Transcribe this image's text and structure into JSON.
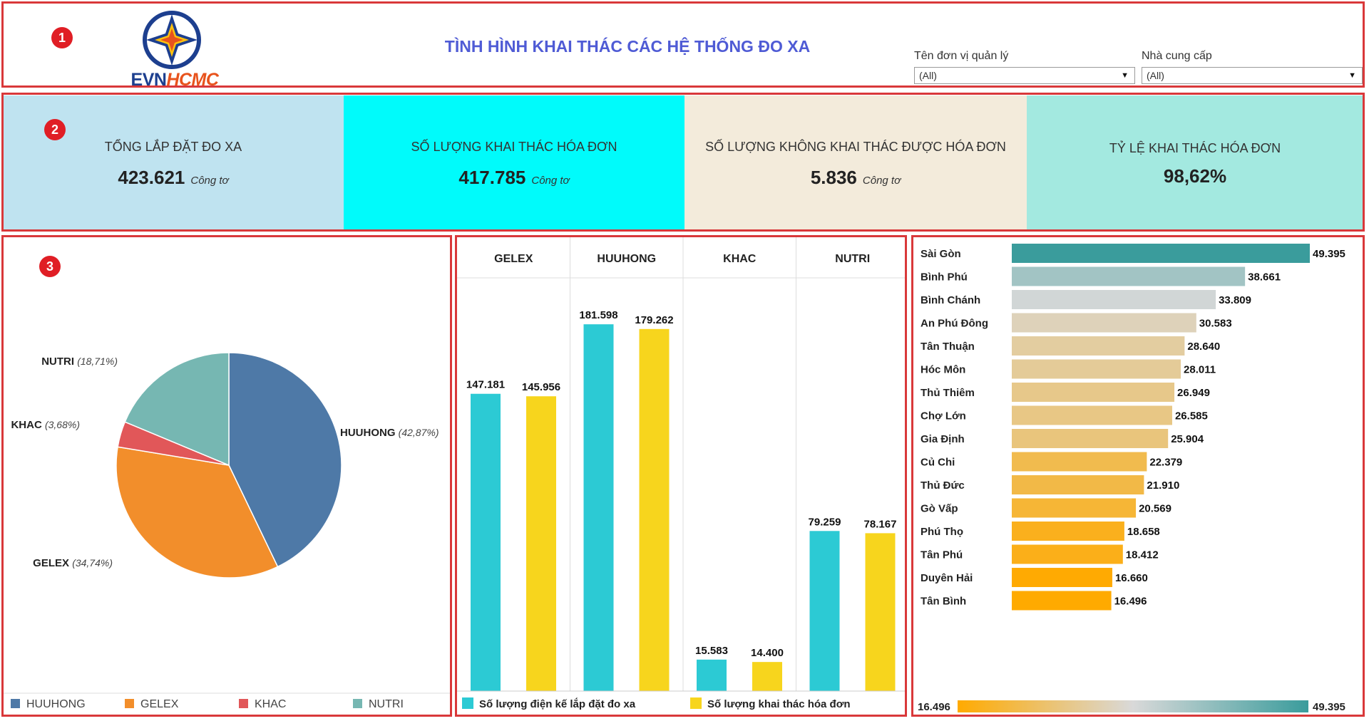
{
  "header": {
    "logo_text_1": "EVN",
    "logo_text_2": "HCMC",
    "title": "TÌNH HÌNH KHAI THÁC CÁC HỆ THỐNG ĐO XA",
    "filters": [
      {
        "label": "Tên đơn vị quản lý",
        "value": "(All)"
      },
      {
        "label": "Nhà cung cấp",
        "value": "(All)"
      }
    ]
  },
  "badges": [
    "1",
    "2",
    "3"
  ],
  "kpis": [
    {
      "label": "TỔNG LẮP ĐẶT ĐO XA",
      "value": "423.621",
      "unit": "Công tơ",
      "bg": "#bfe3f0"
    },
    {
      "label": "SỐ LƯỢNG KHAI THÁC HÓA ĐƠN",
      "value": "417.785",
      "unit": "Công tơ",
      "bg": "#00fbfb"
    },
    {
      "label": "SỐ LƯỢNG KHÔNG KHAI THÁC ĐƯỢC HÓA  ĐƠN",
      "value": "5.836",
      "unit": "Công tơ",
      "bg": "#f3ebdb"
    },
    {
      "label": "TỶ LỆ KHAI THÁC HÓA ĐƠN",
      "value": "98,62%",
      "unit": "",
      "bg": "#a3e9e0"
    }
  ],
  "chart_data": [
    {
      "type": "pie",
      "slices": [
        {
          "name": "HUUHONG",
          "pct_label": "(42,87%)",
          "value": 42.87,
          "color": "#4e79a7"
        },
        {
          "name": "GELEX",
          "pct_label": "(34,74%)",
          "value": 34.74,
          "color": "#f28e2b"
        },
        {
          "name": "KHAC",
          "pct_label": "(3,68%)",
          "value": 3.68,
          "color": "#e15759"
        },
        {
          "name": "NUTRI",
          "pct_label": "(18,71%)",
          "value": 18.71,
          "color": "#76b7b2"
        }
      ],
      "legend": [
        {
          "name": "HUUHONG",
          "color": "#4e79a7"
        },
        {
          "name": "GELEX",
          "color": "#f28e2b"
        },
        {
          "name": "KHAC",
          "color": "#e15759"
        },
        {
          "name": "NUTRI",
          "color": "#76b7b2"
        }
      ],
      "legend_position": "bottom"
    },
    {
      "type": "bar",
      "categories": [
        "GELEX",
        "HUUHONG",
        "KHAC",
        "NUTRI"
      ],
      "series": [
        {
          "name": "Số lượng điện kế lắp đặt đo xa",
          "color": "#2ccad4",
          "values": [
            147181,
            181598,
            15583,
            79259
          ],
          "labels": [
            "147.181",
            "181.598",
            "15.583",
            "79.259"
          ]
        },
        {
          "name": "Số lượng khai thác hóa đơn",
          "color": "#f7d51d",
          "values": [
            145956,
            179262,
            14400,
            78167
          ],
          "labels": [
            "145.956",
            "179.262",
            "14.400",
            "78.167"
          ]
        }
      ],
      "ylim": [
        0,
        200000
      ],
      "legend_position": "bottom"
    },
    {
      "type": "bar",
      "orientation": "horizontal",
      "categories": [
        "Sài Gòn",
        "Bình Phú",
        "Bình Chánh",
        "An Phú Đông",
        "Tân Thuận",
        "Hóc Môn",
        "Thủ Thiêm",
        "Chợ Lớn",
        "Gia Định",
        "Củ Chi",
        "Thủ Đức",
        "Gò Vấp",
        "Phú Thọ",
        "Tân Phú",
        "Duyên Hải",
        "Tân Bình"
      ],
      "values": [
        49395,
        38661,
        33809,
        30583,
        28640,
        28011,
        26949,
        26585,
        25904,
        22379,
        21910,
        20569,
        18658,
        18412,
        16660,
        16496
      ],
      "labels": [
        "49.395",
        "38.661",
        "33.809",
        "30.583",
        "28.640",
        "28.011",
        "26.949",
        "26.585",
        "25.904",
        "22.379",
        "21.910",
        "20.569",
        "18.658",
        "18.412",
        "16.660",
        "16.496"
      ],
      "xlim": [
        0,
        49395
      ],
      "color_scale": {
        "min_label": "16.496",
        "max_label": "49.395",
        "min_color": "#ffaa00",
        "mid_color": "#d9d9d9",
        "max_color": "#3a9c9c"
      }
    }
  ]
}
